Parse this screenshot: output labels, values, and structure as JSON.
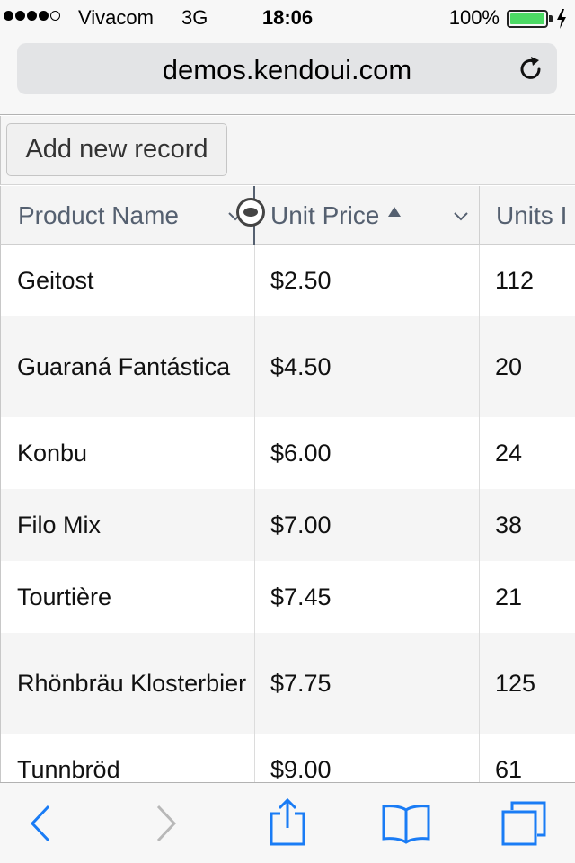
{
  "status_bar": {
    "signal_dots": [
      true,
      true,
      true,
      true,
      false
    ],
    "carrier": "Vivacom",
    "network": "3G",
    "time": "18:06",
    "battery_percent": "100%",
    "battery_color": "#4cd964"
  },
  "browser": {
    "url": "demos.kendoui.com",
    "reload_icon": "reload-icon",
    "toolbar_icons": [
      "back-icon",
      "forward-icon",
      "share-icon",
      "bookmarks-icon",
      "tabs-icon"
    ],
    "accent_color": "#1a7cf5"
  },
  "grid": {
    "toolbar": {
      "add_label": "Add new record"
    },
    "columns": [
      {
        "title": "Product Name"
      },
      {
        "title": "Unit Price",
        "sorted": "ascending"
      },
      {
        "title": "Units I"
      }
    ],
    "rows": [
      {
        "name": "Geitost",
        "price": "$2.50",
        "units": "112"
      },
      {
        "name": "Guaraná Fantástica",
        "price": "$4.50",
        "units": "20"
      },
      {
        "name": "Konbu",
        "price": "$6.00",
        "units": "24"
      },
      {
        "name": "Filo Mix",
        "price": "$7.00",
        "units": "38"
      },
      {
        "name": "Tourtière",
        "price": "$7.45",
        "units": "21"
      },
      {
        "name": "Rhönbräu Klosterbier",
        "price": "$7.75",
        "units": "125"
      },
      {
        "name": "Tunnbröd",
        "price": "$9.00",
        "units": "61"
      }
    ]
  }
}
